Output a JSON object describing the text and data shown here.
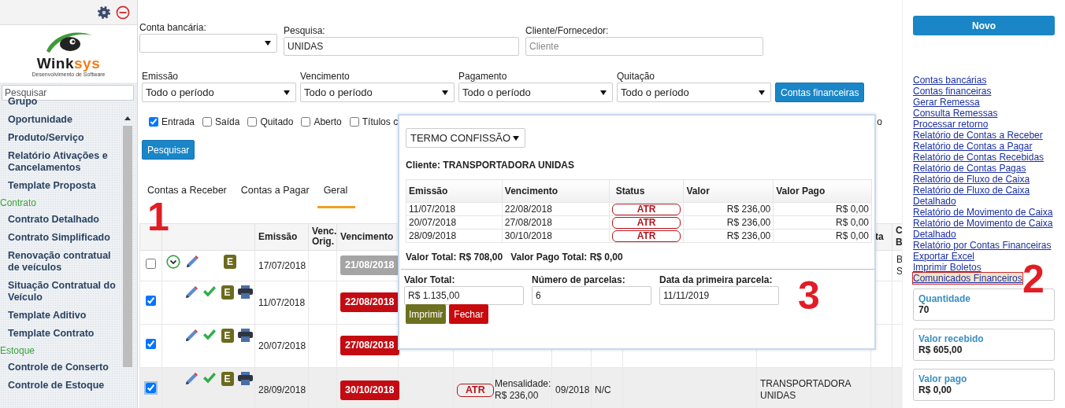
{
  "sidebar": {
    "logo": {
      "name_main": "Wink",
      "name_accent": "sys",
      "tagline": "Desenvolvimento de Software"
    },
    "search": {
      "placeholder": "Pesquisar"
    },
    "menu": [
      {
        "kind": "item",
        "label": "Grupo"
      },
      {
        "kind": "item",
        "label": "Oportunidade"
      },
      {
        "kind": "item",
        "label": "Produto/Serviço"
      },
      {
        "kind": "item",
        "label": "Relatório Ativações e Cancelamentos"
      },
      {
        "kind": "item",
        "label": "Template Proposta"
      },
      {
        "kind": "section",
        "label": "Contrato"
      },
      {
        "kind": "item",
        "label": "Contrato Detalhado"
      },
      {
        "kind": "item",
        "label": "Contrato Simplificado"
      },
      {
        "kind": "item",
        "label": "Renovação contratual de veículos"
      },
      {
        "kind": "item",
        "label": "Situação Contratual do Veículo"
      },
      {
        "kind": "item",
        "label": "Template Aditivo"
      },
      {
        "kind": "item",
        "label": "Template Contrato"
      },
      {
        "kind": "section",
        "label": "Estoque"
      },
      {
        "kind": "item",
        "label": "Controle de Conserto"
      },
      {
        "kind": "item",
        "label": "Controle de Estoque"
      }
    ]
  },
  "filters": {
    "fields": [
      {
        "kind": "select",
        "label": "Conta bancária:"
      },
      {
        "kind": "input",
        "label": "Pesquisa:",
        "value": "UNIDAS"
      },
      {
        "kind": "input",
        "label": "Cliente/Fornecedor:",
        "placeholder": "Cliente"
      }
    ],
    "periods": [
      {
        "label": "Emissão",
        "value": "Todo o período"
      },
      {
        "label": "Vencimento",
        "value": "Todo o período"
      },
      {
        "label": "Pagamento",
        "value": "Todo o período"
      },
      {
        "label": "Quitação",
        "value": "Todo o período"
      }
    ],
    "accounts_button": "Contas financeiras",
    "checks": [
      {
        "label": "Entrada",
        "checked": true
      },
      {
        "label": "Saída",
        "checked": false
      },
      {
        "label": "Quitado",
        "checked": false
      },
      {
        "label": "Aberto",
        "checked": false
      },
      {
        "label": "Títulos c",
        "checked": false
      }
    ],
    "trailing_text": "o",
    "search_button": "Pesquisar"
  },
  "tabs": [
    {
      "label": "Contas a Receber",
      "selected": false
    },
    {
      "label": "Contas a Pagar",
      "selected": false
    },
    {
      "label": "Geral",
      "selected": true
    }
  ],
  "table": {
    "marker": "1",
    "columns": [
      {},
      {},
      {
        "label": "Emissão"
      },
      {
        "label": "Venc. Orig."
      },
      {
        "label": "Vencimento"
      },
      {},
      {},
      {},
      {},
      {},
      {},
      {},
      {
        "label": "ta"
      },
      {
        "label": "C B"
      }
    ],
    "rows": [
      {
        "checked": false,
        "highlighted": false,
        "icons": [
          {
            "kind": "expand"
          },
          {
            "kind": "edit"
          },
          {
            "kind": "blank"
          },
          {
            "kind": "letter",
            "text": "E"
          }
        ],
        "emissao": "17/07/2018",
        "vencimento": "21/08/2018",
        "overdue": false,
        "last": "B S"
      },
      {
        "checked": true,
        "highlighted": false,
        "icons": [
          {
            "kind": "blank"
          },
          {
            "kind": "edit"
          },
          {
            "kind": "check"
          },
          {
            "kind": "letter",
            "text": "E"
          },
          {
            "kind": "print"
          }
        ],
        "emissao": "11/07/2018",
        "vencimento": "22/08/2018",
        "overdue": true
      },
      {
        "checked": true,
        "highlighted": false,
        "icons": [
          {
            "kind": "blank"
          },
          {
            "kind": "edit"
          },
          {
            "kind": "check"
          },
          {
            "kind": "letter",
            "text": "E"
          },
          {
            "kind": "print"
          }
        ],
        "emissao": "20/07/2018",
        "vencimento": "27/08/2018",
        "overdue": true
      },
      {
        "checked": true,
        "highlighted": true,
        "icons": [
          {
            "kind": "blank"
          },
          {
            "kind": "edit"
          },
          {
            "kind": "check"
          },
          {
            "kind": "letter",
            "text": "E"
          },
          {
            "kind": "print"
          }
        ],
        "emissao": "28/09/2018",
        "vencimento": "30/10/2018",
        "overdue": true,
        "status": "ATR",
        "descricao": "Mensalidade: R$ 236,00",
        "competencia": "09/2018",
        "nc": "N/C",
        "cliente": "TRANSPORTADORA UNIDAS"
      }
    ]
  },
  "dialog": {
    "marker": "3",
    "template": "TERMO CONFISSÃO",
    "client": "Cliente: TRANSPORTADORA UNIDAS",
    "columns": [
      "Emissão",
      "Vencimento",
      "Status",
      "Valor",
      "Valor Pago"
    ],
    "rows": [
      {
        "emissao": "11/07/2018",
        "vencimento": "22/08/2018",
        "status": "ATR",
        "valor": "R$ 236,00",
        "valor_pago": "R$ 0,00"
      },
      {
        "emissao": "20/07/2018",
        "vencimento": "27/08/2018",
        "status": "ATR",
        "valor": "R$ 236,00",
        "valor_pago": "R$ 0,00"
      },
      {
        "emissao": "28/09/2018",
        "vencimento": "30/10/2018",
        "status": "ATR",
        "valor": "R$ 236,00",
        "valor_pago": "R$ 0,00"
      }
    ],
    "totals": [
      "Valor Total: R$ 708,00",
      "Valor Pago Total: R$ 0,00"
    ],
    "fields": [
      {
        "label": "Valor Total:",
        "value": "R$ 1.135,00"
      },
      {
        "label": "Número de parcelas:",
        "value": "6"
      },
      {
        "label": "Data da primeira parcela:",
        "value": "11/11/2019"
      }
    ],
    "buttons": [
      {
        "kind": "print",
        "label": "Imprimir"
      },
      {
        "kind": "close",
        "label": "Fechar"
      }
    ]
  },
  "right_panel": {
    "new_button": "Novo",
    "marker": "2",
    "links": [
      {
        "label": "Contas bancárias",
        "highlighted": false
      },
      {
        "label": "Contas financeiras",
        "highlighted": false
      },
      {
        "label": "Gerar Remessa",
        "highlighted": false
      },
      {
        "label": "Consulta Remessas",
        "highlighted": false
      },
      {
        "label": "Processar retorno",
        "highlighted": false
      },
      {
        "label": "Relatório de Contas a Receber",
        "highlighted": false
      },
      {
        "label": "Relatório de Contas a Pagar",
        "highlighted": false
      },
      {
        "label": "Relatório de Contas Recebidas",
        "highlighted": false
      },
      {
        "label": "Relatório de Contas Pagas",
        "highlighted": false
      },
      {
        "label": "Relatório de Fluxo de Caixa",
        "highlighted": false
      },
      {
        "label": "Relatório de Fluxo de Caixa Detalhado",
        "highlighted": false
      },
      {
        "label": "Relatório de Movimento de Caixa",
        "highlighted": false
      },
      {
        "label": "Relatório de Movimento de Caixa Detalhado",
        "highlighted": false
      },
      {
        "label": "Relatório por Contas Financeiras",
        "highlighted": false
      },
      {
        "label": "Exportar Excel",
        "highlighted": false
      },
      {
        "label": "Imprimir Boletos",
        "highlighted": false
      },
      {
        "label": "Comunicados Financeiros",
        "highlighted": true
      }
    ],
    "stats": [
      {
        "label": "Quantidade",
        "value": "70"
      },
      {
        "label": "Valor recebido",
        "value": "R$ 605,00"
      },
      {
        "label": "Valor pago",
        "value": "R$ 0,00"
      }
    ]
  }
}
